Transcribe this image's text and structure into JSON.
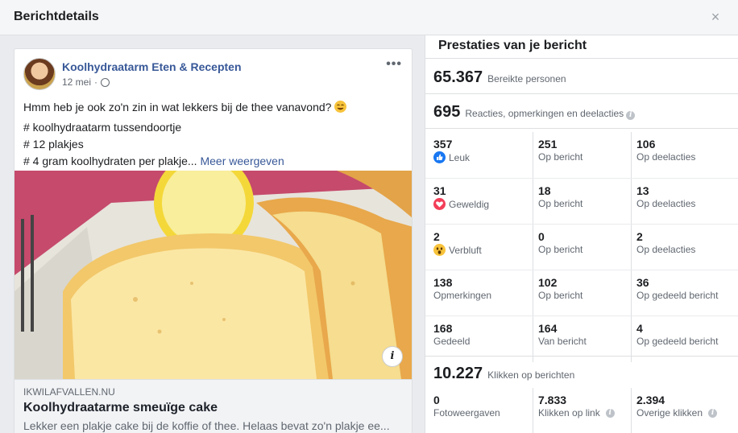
{
  "modal": {
    "title": "Berichtdetails",
    "close_glyph": "×"
  },
  "post": {
    "page_name": "Koolhydraatarm Eten & Recepten",
    "date": "12 mei",
    "meta_separator": "·",
    "more_glyph": "•••",
    "text_line1": "Hmm heb je ook zo'n zin in wat lekkers bij de thee vanavond?",
    "hashtags": [
      "# koolhydraatarm tussendoortje",
      "# 12 plakjes",
      "# 4 gram koolhydraten per plakje..."
    ],
    "see_more": "Meer weergeven",
    "link": {
      "domain": "IKWILAFVALLEN.NU",
      "title": "Koolhydraatarme smeuïge cake",
      "description": "Lekker een plakje cake bij de koffie of thee. Helaas bevat zo'n plakje ee..."
    },
    "info_glyph": "i"
  },
  "performance": {
    "title": "Prestaties van je bericht",
    "reach": {
      "value": "65.367",
      "label": "Bereikte personen"
    },
    "engagement": {
      "value": "695",
      "label": "Reacties, opmerkingen en deelacties"
    },
    "rows": [
      {
        "icon": "like-reaction-icon",
        "cells": [
          {
            "num": "357",
            "lbl": "Leuk"
          },
          {
            "num": "251",
            "lbl": "Op bericht"
          },
          {
            "num": "106",
            "lbl": "Op deelacties"
          }
        ]
      },
      {
        "icon": "love-reaction-icon",
        "cells": [
          {
            "num": "31",
            "lbl": "Geweldig"
          },
          {
            "num": "18",
            "lbl": "Op bericht"
          },
          {
            "num": "13",
            "lbl": "Op deelacties"
          }
        ]
      },
      {
        "icon": "wow-reaction-icon",
        "cells": [
          {
            "num": "2",
            "lbl": "Verbluft"
          },
          {
            "num": "0",
            "lbl": "Op bericht"
          },
          {
            "num": "2",
            "lbl": "Op deelacties"
          }
        ]
      },
      {
        "icon": "",
        "cells": [
          {
            "num": "138",
            "lbl": "Opmerkingen"
          },
          {
            "num": "102",
            "lbl": "Op bericht"
          },
          {
            "num": "36",
            "lbl": "Op gedeeld bericht"
          }
        ]
      },
      {
        "icon": "",
        "cells": [
          {
            "num": "168",
            "lbl": "Gedeeld"
          },
          {
            "num": "164",
            "lbl": "Van bericht"
          },
          {
            "num": "4",
            "lbl": "Op gedeeld bericht"
          }
        ]
      }
    ],
    "clicks": {
      "value": "10.227",
      "label": "Klikken op berichten"
    },
    "clicks_row": [
      {
        "num": "0",
        "lbl": "Fotoweergaven"
      },
      {
        "num": "7.833",
        "lbl": "Klikken op link"
      },
      {
        "num": "2.394",
        "lbl": "Overige klikken"
      }
    ]
  }
}
